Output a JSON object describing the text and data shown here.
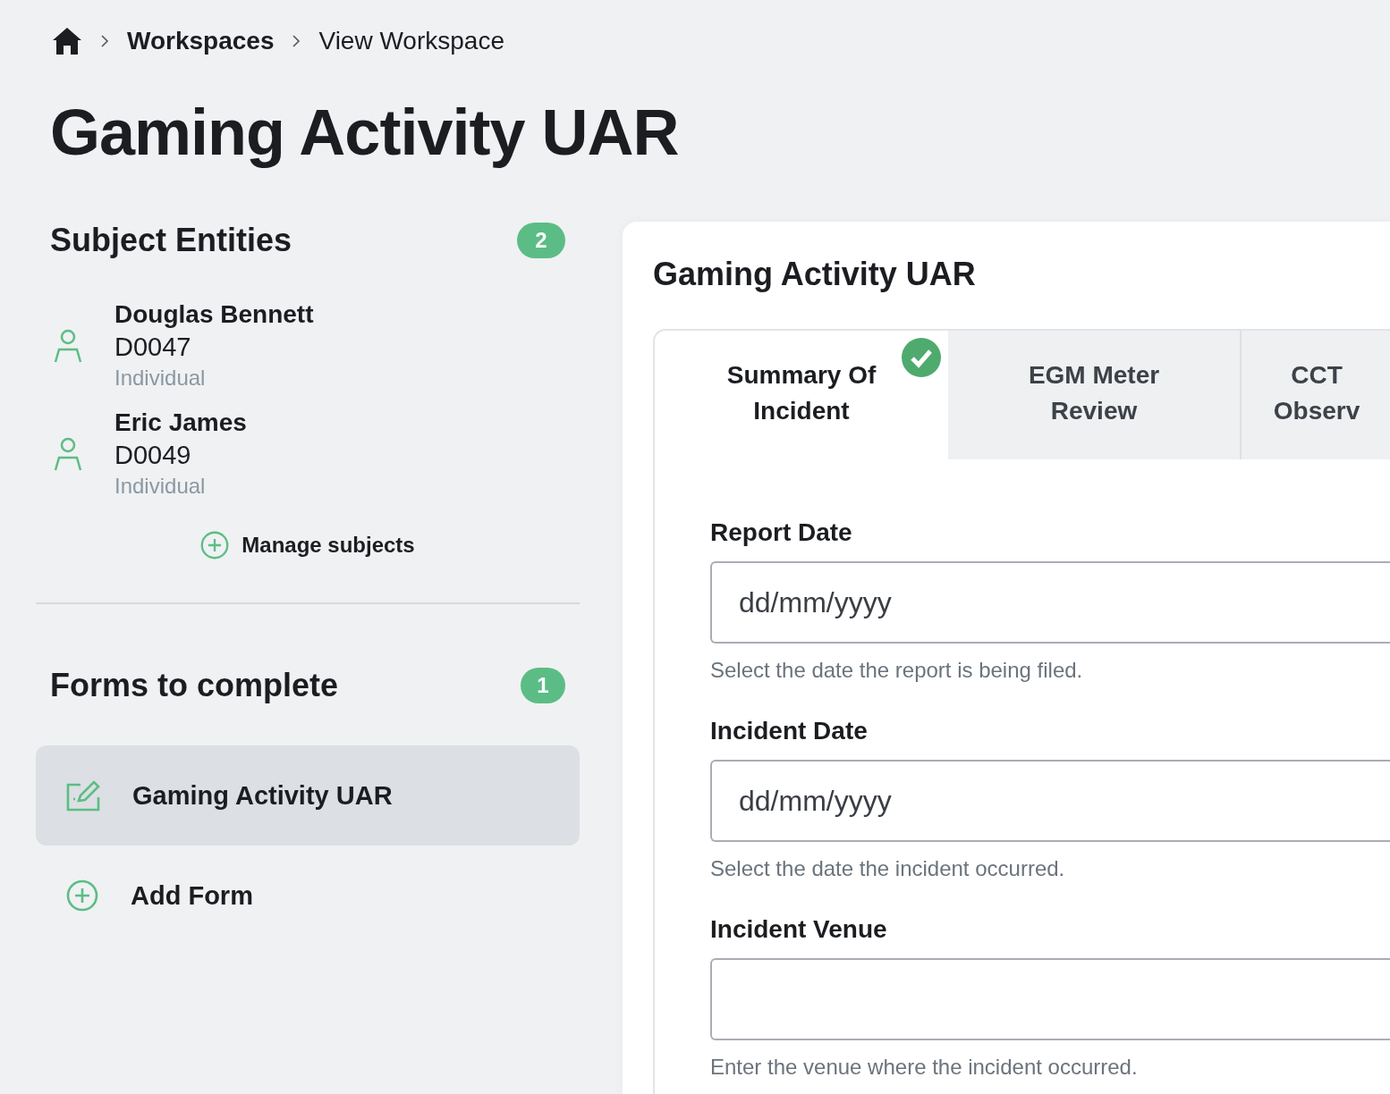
{
  "breadcrumb": [
    {
      "label": "Workspaces",
      "current": false
    },
    {
      "label": "View Workspace",
      "current": true
    }
  ],
  "title": "Gaming Activity UAR",
  "subjects": {
    "title": "Subject Entities",
    "count": "2",
    "items": [
      {
        "name": "Douglas Bennett",
        "id": "D0047",
        "type": "Individual"
      },
      {
        "name": "Eric James",
        "id": "D0049",
        "type": "Individual"
      }
    ],
    "action": "Manage subjects"
  },
  "forms": {
    "title": "Forms to complete",
    "count": "1",
    "items": [
      {
        "label": "Gaming Activity UAR",
        "selected": true
      }
    ],
    "action": "Add Form"
  },
  "panel": {
    "title": "Gaming Activity UAR",
    "tabs": [
      {
        "label": "Summary Of Incident",
        "selected": true,
        "completed": true
      },
      {
        "label": "EGM Meter Review",
        "selected": false,
        "completed": false
      },
      {
        "label": "CCT Observ",
        "selected": false,
        "completed": false
      }
    ],
    "fields": [
      {
        "label": "Report Date",
        "placeholder": "dd/mm/yyyy",
        "help": "Select the date the report is being filed."
      },
      {
        "label": "Incident Date",
        "placeholder": "dd/mm/yyyy",
        "help": "Select the date the incident occurred."
      },
      {
        "label": "Incident Venue",
        "help": "Enter the venue where the incident occurred."
      }
    ]
  }
}
